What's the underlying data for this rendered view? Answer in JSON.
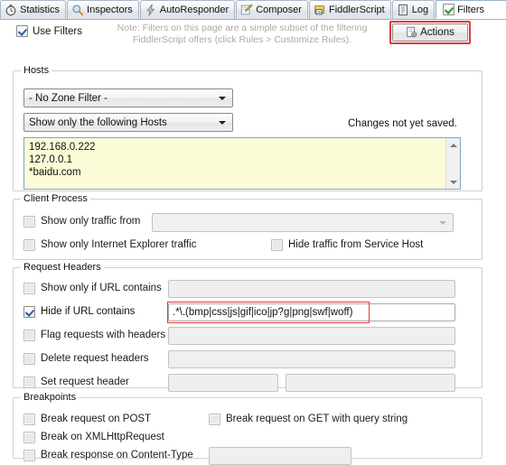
{
  "tabs": [
    {
      "label": "Statistics",
      "icon": "stopwatch-icon",
      "active": false
    },
    {
      "label": "Inspectors",
      "icon": "magnifier-icon",
      "active": false
    },
    {
      "label": "AutoResponder",
      "icon": "lightning-icon",
      "active": false
    },
    {
      "label": "Composer",
      "icon": "pencil-note-icon",
      "active": false
    },
    {
      "label": "FiddlerScript",
      "icon": "js-scroll-icon",
      "active": false
    },
    {
      "label": "Log",
      "icon": "log-document-icon",
      "active": false
    },
    {
      "label": "Filters",
      "icon": "green-check-icon",
      "active": true
    }
  ],
  "header": {
    "use_filters_label": "Use Filters",
    "use_filters_checked": true,
    "note_line1": "Note: Filters on this page are a simple subset of the filtering",
    "note_line2": "FiddlerScript offers (click Rules > Customize Rules).",
    "actions_label": "Actions",
    "actions_icon": "actions-gear-icon"
  },
  "hosts": {
    "title": "Hosts",
    "zone_filter_value": "- No Zone Filter -",
    "host_mode_value": "Show only the following Hosts",
    "host_list_text": "192.168.0.222\n127.0.0.1\n*baidu.com",
    "status_text": "Changes not yet saved."
  },
  "client_process": {
    "title": "Client Process",
    "show_only_traffic_from_label": "Show only traffic from",
    "show_only_traffic_from_checked": false,
    "process_select_value": "",
    "show_only_ie_label": "Show only Internet Explorer traffic",
    "show_only_ie_checked": false,
    "hide_service_host_label": "Hide traffic from Service Host",
    "hide_service_host_checked": false
  },
  "request_headers": {
    "title": "Request Headers",
    "rows": [
      {
        "label": "Show only if URL contains",
        "checked": false,
        "value": ""
      },
      {
        "label": "Hide if URL contains",
        "checked": true,
        "value": ".*\\.(bmp|css|js|gif|ico|jp?g|png|swf|woff)"
      },
      {
        "label": "Flag requests with headers",
        "checked": false,
        "value": ""
      },
      {
        "label": "Delete request headers",
        "checked": false,
        "value": ""
      },
      {
        "label": "Set request header",
        "checked": false,
        "value": "",
        "value2": ""
      }
    ]
  },
  "breakpoints": {
    "title": "Breakpoints",
    "break_post_label": "Break request on POST",
    "break_post_checked": false,
    "break_get_label": "Break request on GET with query string",
    "break_get_checked": false,
    "break_xhr_label": "Break on XMLHttpRequest",
    "break_xhr_checked": false,
    "break_response_label": "Break response on Content-Type",
    "break_response_checked": false,
    "break_response_value": ""
  },
  "colors": {
    "highlight_red": "#e03a3a",
    "host_list_bg": "#fbfbd8",
    "accent_blue": "#2a5fa5",
    "check_green": "#1f9b23",
    "note_gray": "#a9a9a9"
  }
}
